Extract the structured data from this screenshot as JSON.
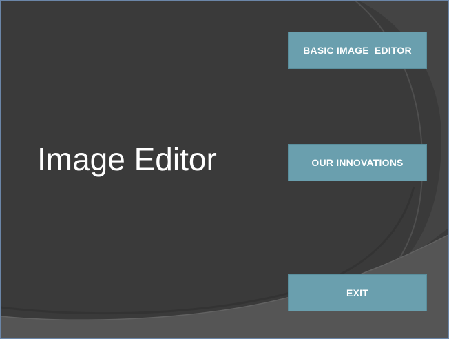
{
  "title": "Image Editor",
  "buttons": {
    "basic_editor": "BASIC IMAGE  EDITOR",
    "innovations": "OUR INNOVATIONS",
    "exit": "EXIT"
  },
  "colors": {
    "background": "#3a3a3a",
    "button": "#6a9fae",
    "text": "#ffffff"
  }
}
